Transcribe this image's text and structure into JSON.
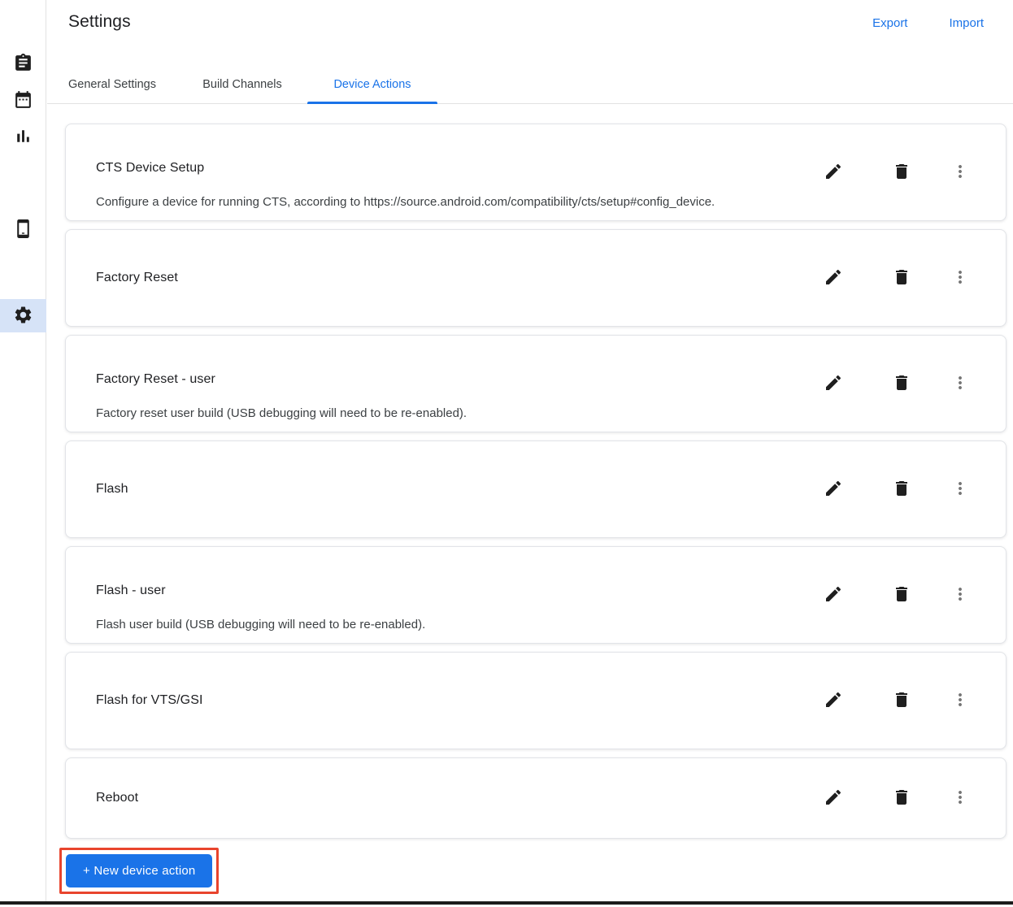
{
  "header": {
    "title": "Settings",
    "export_label": "Export",
    "import_label": "Import"
  },
  "sidebar": {
    "items": [
      {
        "icon": "assignment-icon",
        "selected": false
      },
      {
        "icon": "calendar-icon",
        "selected": false
      },
      {
        "icon": "bar-chart-icon",
        "selected": false
      },
      {
        "icon": "smartphone-icon",
        "selected": false
      },
      {
        "icon": "settings-gear-icon",
        "selected": true
      }
    ]
  },
  "tabs": [
    {
      "label": "General Settings",
      "active": false
    },
    {
      "label": "Build Channels",
      "active": false
    },
    {
      "label": "Device Actions",
      "active": true
    }
  ],
  "device_actions": [
    {
      "title": "CTS Device Setup",
      "description": "Configure a device for running CTS, according to https://source.android.com/compatibility/cts/setup#config_device."
    },
    {
      "title": "Factory Reset",
      "description": ""
    },
    {
      "title": "Factory Reset - user",
      "description": "Factory reset user build (USB debugging will need to be re-enabled)."
    },
    {
      "title": "Flash",
      "description": ""
    },
    {
      "title": "Flash - user",
      "description": "Flash user build (USB debugging will need to be re-enabled)."
    },
    {
      "title": "Flash for VTS/GSI",
      "description": ""
    },
    {
      "title": "Reboot",
      "description": ""
    }
  ],
  "card_actions": {
    "edit": "edit-icon",
    "delete": "delete-icon",
    "more": "more-vert-icon"
  },
  "new_action_button": {
    "label": "+ New device action"
  },
  "colors": {
    "accent": "#1a73e8",
    "annotation_highlight": "#e8442d",
    "selected_nav_bg": "#d6e3f7"
  }
}
